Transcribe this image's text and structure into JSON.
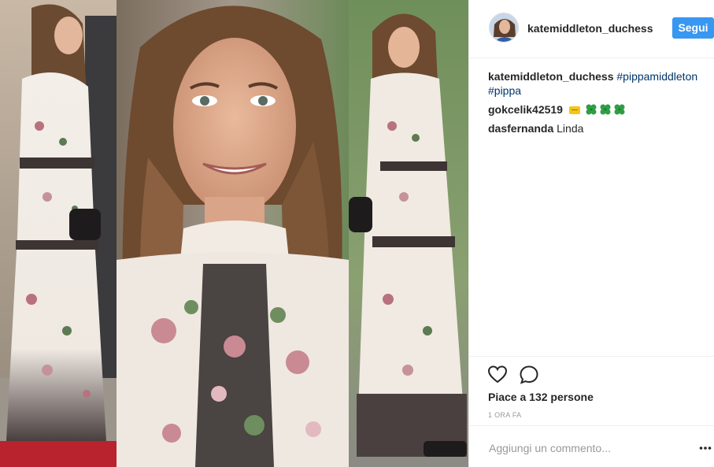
{
  "post": {
    "image_alt": "Pippa Middleton in a floral long-sleeve maxi dress",
    "panels": [
      "left-full-length",
      "center-closeup",
      "right-full-length"
    ]
  },
  "header": {
    "username": "katemiddleton_duchess",
    "follow_label": "Segui"
  },
  "comments": [
    {
      "user": "katemiddleton_duchess",
      "text": "",
      "hashtags": [
        "#pippamiddleton",
        "#pippa"
      ]
    },
    {
      "user": "gokcelik42519",
      "text": "",
      "emojis": [
        "ticket",
        "four-leaf-clover",
        "four-leaf-clover",
        "four-leaf-clover"
      ]
    },
    {
      "user": "dasfernanda",
      "text": "Linda"
    }
  ],
  "actions": {
    "like_icon": "heart-icon",
    "comment_icon": "comment-icon",
    "likes_text": "Piace a 132 persone",
    "time_text": "1 ORA FA"
  },
  "add_comment": {
    "placeholder": "Aggiungi un commento...",
    "more_icon": "more-options-icon"
  },
  "colors": {
    "accent": "#3897f0",
    "hashtag": "#003569",
    "border": "#efefef"
  }
}
